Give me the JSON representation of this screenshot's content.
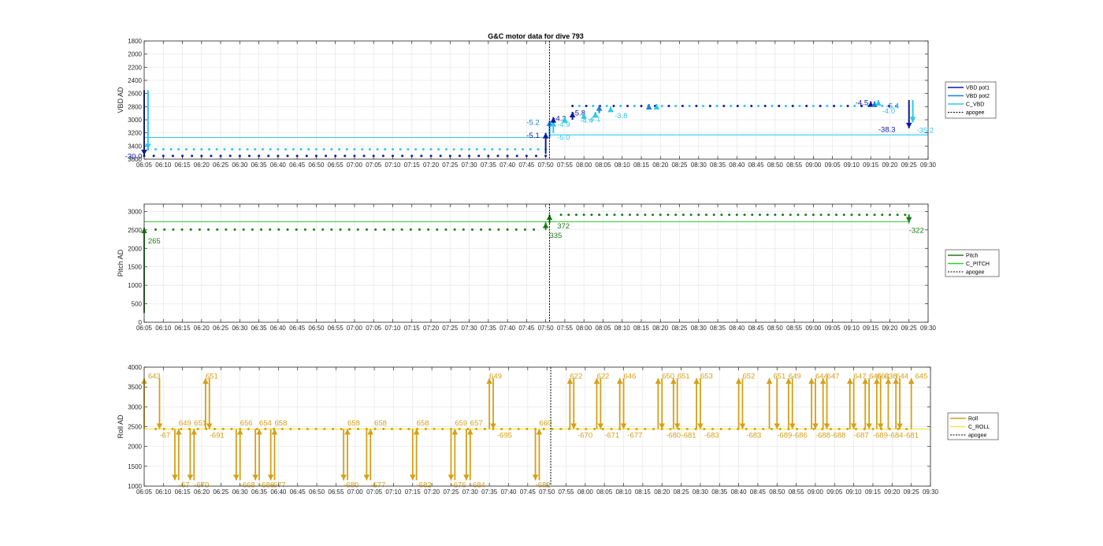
{
  "title": "G&C motor data for dive 793",
  "time_ticks": [
    "06:05",
    "06:10",
    "06:15",
    "06:20",
    "06:25",
    "06:30",
    "06:35",
    "06:40",
    "06:45",
    "06:50",
    "06:55",
    "07:00",
    "07:05",
    "07:10",
    "07:15",
    "07:20",
    "07:25",
    "07:30",
    "07:35",
    "07:40",
    "07:45",
    "07:50",
    "07:55",
    "08:00",
    "08:05",
    "08:10",
    "08:15",
    "08:20",
    "08:25",
    "08:30",
    "08:35",
    "08:40",
    "08:45",
    "08:50",
    "08:55",
    "09:00",
    "09:05",
    "09:10",
    "09:15",
    "09:20",
    "09:25",
    "09:30"
  ],
  "colors": {
    "vbd_pot1": "#0b1a9e",
    "vbd_pot2": "#1e7fe0",
    "c_vbd": "#2fc8e8",
    "pitch": "#1f7a1f",
    "c_pitch": "#33cc33",
    "roll": "#d4a017",
    "c_roll": "#f2e64a",
    "apogee": "#000000"
  },
  "chart_data": [
    {
      "type": "line",
      "ylabel": "VBD AD",
      "ylim": [
        1800,
        3600
      ],
      "y_reversed": true,
      "y_ticks": [
        1800,
        2000,
        2200,
        2400,
        2600,
        2800,
        3000,
        3200,
        3400,
        3600
      ],
      "grid": true,
      "legend": "right",
      "legend_entries": [
        "VBD pot1",
        "VBD pot2",
        "C_VBD",
        "apogee"
      ],
      "apogee_time": "07:51",
      "c_vbd_steps": [
        [
          "06:05",
          3270
        ],
        [
          "07:51",
          3270
        ],
        [
          "07:51",
          3230
        ],
        [
          "09:30",
          3230
        ]
      ],
      "vbd_pot1_points": {
        "t_start": "06:05",
        "t_end": "07:50",
        "step_min": 2.5,
        "value": 3550
      },
      "vbd_pot2_points": {
        "t_start": "06:06",
        "t_end": "07:50",
        "step_min": 2.0,
        "value": 3450
      },
      "vbd_after_apogee": {
        "t_start": "07:57",
        "t_end": "09:23",
        "step_min": 1.8,
        "value": 2790
      },
      "moves": [
        {
          "t": "06:05",
          "from": 2550,
          "to": 3540,
          "series": "vbd_pot1",
          "label": "-30.0",
          "lt": "06:00",
          "lv": 3560
        },
        {
          "t": "06:06",
          "from": 2550,
          "to": 3450,
          "series": "c_vbd",
          "label": "",
          "lt": "06:06",
          "lv": 3450
        },
        {
          "t": "07:50",
          "from": 3520,
          "to": 3200,
          "series": "vbd_pot1",
          "label": "-5.1",
          "lt": "07:45",
          "lv": 3240
        },
        {
          "t": "07:51",
          "from": 3280,
          "to": 3010,
          "series": "vbd_pot2",
          "label": "-5.2",
          "lt": "07:45",
          "lv": 3040
        },
        {
          "t": "07:52",
          "from": 3200,
          "to": 3020,
          "series": "c_vbd",
          "label": "-5.0",
          "lt": "07:53",
          "lv": 3270
        },
        {
          "t": "07:52",
          "from": 3050,
          "to": 2960,
          "series": "vbd_pot1",
          "label": "-4.3",
          "lt": "07:52",
          "lv": 2980
        },
        {
          "t": "07:55",
          "from": 3050,
          "to": 2960,
          "series": "c_vbd",
          "label": "-4.9",
          "lt": "07:53",
          "lv": 3070
        },
        {
          "t": "07:57",
          "from": 3000,
          "to": 2880,
          "series": "vbd_pot1",
          "label": "-5.8",
          "lt": "07:57",
          "lv": 2900
        },
        {
          "t": "08:00",
          "from": 2990,
          "to": 2900,
          "series": "c_vbd",
          "label": "-4.4",
          "lt": "07:59",
          "lv": 3010
        },
        {
          "t": "08:03",
          "from": 2970,
          "to": 2880,
          "series": "c_vbd",
          "label": "-4.1",
          "lt": "08:01",
          "lv": 2990
        },
        {
          "t": "08:04",
          "from": 2900,
          "to": 2780,
          "series": "vbd_pot2",
          "label": "",
          "lt": "08:04",
          "lv": 2780
        },
        {
          "t": "08:07",
          "from": 2850,
          "to": 2800,
          "series": "c_vbd",
          "label": "-3.8",
          "lt": "08:08",
          "lv": 2940
        },
        {
          "t": "08:17",
          "from": 2820,
          "to": 2760,
          "series": "vbd_pot2",
          "label": "",
          "lt": "08:17",
          "lv": 2760
        },
        {
          "t": "08:19",
          "from": 2820,
          "to": 2760,
          "series": "c_vbd",
          "label": "",
          "lt": "08:19",
          "lv": 2760
        },
        {
          "t": "09:15",
          "from": 2780,
          "to": 2720,
          "series": "vbd_pot1",
          "label": "-4.5",
          "lt": "09:11",
          "lv": 2740
        },
        {
          "t": "09:16",
          "from": 2780,
          "to": 2720,
          "series": "vbd_pot2",
          "label": "-5.4",
          "lt": "09:19",
          "lv": 2790
        },
        {
          "t": "09:17",
          "from": 2780,
          "to": 2700,
          "series": "c_vbd",
          "label": "-4.0",
          "lt": "09:18",
          "lv": 2870
        },
        {
          "t": "09:25",
          "from": 2700,
          "to": 3130,
          "series": "vbd_pot1",
          "label": "-38.3",
          "lt": "09:17",
          "lv": 3150
        },
        {
          "t": "09:26",
          "from": 2700,
          "to": 3040,
          "series": "c_vbd",
          "label": "-35.2",
          "lt": "09:27",
          "lv": 3160
        }
      ]
    },
    {
      "type": "line",
      "ylabel": "Pitch AD",
      "ylim": [
        0,
        3200
      ],
      "y_ticks": [
        0,
        500,
        1000,
        1500,
        2000,
        2500,
        3000
      ],
      "grid": true,
      "legend": "right",
      "legend_entries": [
        "Pitch",
        "C_PITCH",
        "apogee"
      ],
      "apogee_time": "07:51",
      "c_pitch": [
        [
          "06:05",
          2720
        ],
        [
          "09:25",
          2720
        ],
        [
          "09:25",
          2660
        ]
      ],
      "pitch_before": {
        "t_start": "06:08",
        "t_end": "07:48",
        "step_min": 2.3,
        "value": 2510
      },
      "pitch_after": {
        "t_start": "07:54",
        "t_end": "09:24",
        "step_min": 2.0,
        "value": 2910
      },
      "moves": [
        {
          "t": "06:05",
          "from": 250,
          "to": 2560,
          "label": "265",
          "lt": "06:06",
          "lv": 2200
        },
        {
          "t": "07:50",
          "from": 2500,
          "to": 2700,
          "label": "335",
          "lt": "07:51",
          "lv": 2350
        },
        {
          "t": "07:51",
          "from": 2680,
          "to": 2920,
          "label": "372",
          "lt": "07:53",
          "lv": 2600
        },
        {
          "t": "09:25",
          "from": 2920,
          "to": 2700,
          "label": "-322",
          "lt": "09:25",
          "lv": 2490
        }
      ]
    },
    {
      "type": "line",
      "ylabel": "Roll AD",
      "ylim": [
        1000,
        4000
      ],
      "y_ticks": [
        1000,
        1500,
        2000,
        2500,
        3000,
        3500,
        4000
      ],
      "grid": true,
      "legend": "right",
      "legend_entries": [
        "Roll",
        "C_ROLL",
        "apogee"
      ],
      "apogee_time": "07:51",
      "c_roll_value": 2440,
      "roll_points": {
        "t_start": "06:08",
        "t_end": "09:24",
        "step_min": 2.2,
        "value": 2440
      },
      "moves": [
        {
          "t": "06:05",
          "from": 2440,
          "to": 3720,
          "label": "643",
          "lt": "06:06",
          "lv": 3770
        },
        {
          "t": "06:09",
          "from": 3720,
          "to": 2440,
          "label": "-67",
          "lt": "06:09",
          "lv": 2280
        },
        {
          "t": "06:13",
          "from": 2440,
          "to": 1150,
          "label": "-67",
          "lt": "06:14",
          "lv": 1030
        },
        {
          "t": "06:14",
          "from": 1150,
          "to": 2440,
          "label": "649",
          "lt": "06:14",
          "lv": 2590
        },
        {
          "t": "06:17",
          "from": 2440,
          "to": 1150,
          "label": "-670",
          "lt": "06:18",
          "lv": 1030
        },
        {
          "t": "06:18",
          "from": 1150,
          "to": 2440,
          "label": "651",
          "lt": "06:18",
          "lv": 2590
        },
        {
          "t": "06:21",
          "from": 2440,
          "to": 3720,
          "label": "651",
          "lt": "06:21",
          "lv": 3770
        },
        {
          "t": "06:22",
          "from": 3720,
          "to": 2440,
          "label": "-691",
          "lt": "06:22",
          "lv": 2280
        },
        {
          "t": "06:29",
          "from": 2440,
          "to": 1150,
          "label": "-668",
          "lt": "06:30",
          "lv": 1030
        },
        {
          "t": "06:30",
          "from": 1150,
          "to": 2440,
          "label": "656",
          "lt": "06:30",
          "lv": 2590
        },
        {
          "t": "06:34",
          "from": 2440,
          "to": 1150,
          "label": "-686",
          "lt": "06:35",
          "lv": 1030
        },
        {
          "t": "06:35",
          "from": 1150,
          "to": 2440,
          "label": "654",
          "lt": "06:35",
          "lv": 2590
        },
        {
          "t": "06:38",
          "from": 2440,
          "to": 1150,
          "label": "-677",
          "lt": "06:38",
          "lv": 1030
        },
        {
          "t": "06:39",
          "from": 1150,
          "to": 2440,
          "label": "658",
          "lt": "06:39",
          "lv": 2590
        },
        {
          "t": "06:57",
          "from": 2440,
          "to": 1150,
          "label": "-680",
          "lt": "06:57",
          "lv": 1030
        },
        {
          "t": "06:58",
          "from": 1150,
          "to": 2440,
          "label": "658",
          "lt": "06:58",
          "lv": 2590
        },
        {
          "t": "07:03",
          "from": 2440,
          "to": 1150,
          "label": "-677",
          "lt": "07:04",
          "lv": 1030
        },
        {
          "t": "07:04",
          "from": 1150,
          "to": 2440,
          "label": "658",
          "lt": "07:05",
          "lv": 2590
        },
        {
          "t": "07:15",
          "from": 2440,
          "to": 1150,
          "label": "-682",
          "lt": "07:16",
          "lv": 1030
        },
        {
          "t": "07:16",
          "from": 1150,
          "to": 2440,
          "label": "658",
          "lt": "07:16",
          "lv": 2590
        },
        {
          "t": "07:25",
          "from": 2440,
          "to": 1150,
          "label": "-676",
          "lt": "07:25",
          "lv": 1030
        },
        {
          "t": "07:26",
          "from": 1150,
          "to": 2440,
          "label": "659",
          "lt": "07:26",
          "lv": 2590
        },
        {
          "t": "07:29",
          "from": 2440,
          "to": 1150,
          "label": "-684",
          "lt": "07:30",
          "lv": 1030
        },
        {
          "t": "07:30",
          "from": 1150,
          "to": 2440,
          "label": "657",
          "lt": "07:30",
          "lv": 2590
        },
        {
          "t": "07:35",
          "from": 2440,
          "to": 3720,
          "label": "649",
          "lt": "07:35",
          "lv": 3770
        },
        {
          "t": "07:36",
          "from": 3720,
          "to": 2440,
          "label": "-695",
          "lt": "07:37",
          "lv": 2280
        },
        {
          "t": "07:47",
          "from": 2440,
          "to": 1150,
          "label": "-682",
          "lt": "07:47",
          "lv": 1030
        },
        {
          "t": "07:48",
          "from": 1150,
          "to": 2440,
          "label": "660",
          "lt": "07:48",
          "lv": 2590
        },
        {
          "t": "07:56",
          "from": 2440,
          "to": 3720,
          "label": "622",
          "lt": "07:56",
          "lv": 3770
        },
        {
          "t": "07:57",
          "from": 3720,
          "to": 2440,
          "label": "-670",
          "lt": "07:58",
          "lv": 2280
        },
        {
          "t": "08:03",
          "from": 2440,
          "to": 3720,
          "label": "622",
          "lt": "08:03",
          "lv": 3770
        },
        {
          "t": "08:04",
          "from": 3720,
          "to": 2440,
          "label": "-671",
          "lt": "08:05",
          "lv": 2280
        },
        {
          "t": "08:09",
          "from": 2440,
          "to": 3720,
          "label": "646",
          "lt": "08:10",
          "lv": 3770
        },
        {
          "t": "08:10",
          "from": 3720,
          "to": 2440,
          "label": "-677",
          "lt": "08:11",
          "lv": 2280
        },
        {
          "t": "08:19",
          "from": 2440,
          "to": 3720,
          "label": "650",
          "lt": "08:20",
          "lv": 3770
        },
        {
          "t": "08:20",
          "from": 3720,
          "to": 2440,
          "label": "-680",
          "lt": "08:21",
          "lv": 2280
        },
        {
          "t": "08:23",
          "from": 2440,
          "to": 3720,
          "label": "651",
          "lt": "08:24",
          "lv": 3770
        },
        {
          "t": "08:24",
          "from": 3720,
          "to": 2440,
          "label": "-681",
          "lt": "08:25",
          "lv": 2280
        },
        {
          "t": "08:29",
          "from": 2440,
          "to": 3720,
          "label": "653",
          "lt": "08:30",
          "lv": 3770
        },
        {
          "t": "08:30",
          "from": 3720,
          "to": 2440,
          "label": "-683",
          "lt": "08:31",
          "lv": 2280
        },
        {
          "t": "08:40",
          "from": 2440,
          "to": 3720,
          "label": "652",
          "lt": "08:41",
          "lv": 3770
        },
        {
          "t": "08:41",
          "from": 3720,
          "to": 2440,
          "label": "-683",
          "lt": "08:42",
          "lv": 2280
        },
        {
          "t": "08:48",
          "from": 2440,
          "to": 3720,
          "label": "651",
          "lt": "08:49",
          "lv": 3770
        },
        {
          "t": "08:50",
          "from": 3720,
          "to": 2440,
          "label": "-689",
          "lt": "08:50",
          "lv": 2280
        },
        {
          "t": "08:53",
          "from": 2440,
          "to": 3720,
          "label": "649",
          "lt": "08:53",
          "lv": 3770
        },
        {
          "t": "08:54",
          "from": 3720,
          "to": 2440,
          "label": "-686",
          "lt": "08:54",
          "lv": 2280
        },
        {
          "t": "08:59",
          "from": 2440,
          "to": 3720,
          "label": "644",
          "lt": "09:00",
          "lv": 3770
        },
        {
          "t": "09:00",
          "from": 3720,
          "to": 2440,
          "label": "-688",
          "lt": "09:00",
          "lv": 2280
        },
        {
          "t": "09:02",
          "from": 2440,
          "to": 3720,
          "label": "647",
          "lt": "09:03",
          "lv": 3770
        },
        {
          "t": "09:03",
          "from": 3720,
          "to": 2440,
          "label": "-688",
          "lt": "09:04",
          "lv": 2280
        },
        {
          "t": "09:09",
          "from": 2440,
          "to": 3720,
          "label": "647",
          "lt": "09:10",
          "lv": 3770
        },
        {
          "t": "09:10",
          "from": 3720,
          "to": 2440,
          "label": "-687",
          "lt": "09:10",
          "lv": 2280
        },
        {
          "t": "09:13",
          "from": 2440,
          "to": 3720,
          "label": "646",
          "lt": "09:14",
          "lv": 3770
        },
        {
          "t": "09:14",
          "from": 3720,
          "to": 2440,
          "label": "-689",
          "lt": "09:15",
          "lv": 2280
        },
        {
          "t": "09:16",
          "from": 2440,
          "to": 3720,
          "label": "663",
          "lt": "09:16",
          "lv": 3770
        },
        {
          "t": "09:17",
          "from": 3720,
          "to": 2440,
          "label": "-684",
          "lt": "09:19",
          "lv": 2280
        },
        {
          "t": "09:19",
          "from": 2440,
          "to": 3720,
          "label": "638",
          "lt": "09:18",
          "lv": 3770
        },
        {
          "t": "09:21",
          "from": 2440,
          "to": 3720,
          "label": "644",
          "lt": "09:21",
          "lv": 3770
        },
        {
          "t": "09:22",
          "from": 3720,
          "to": 2440,
          "label": "-681",
          "lt": "09:23",
          "lv": 2280
        },
        {
          "t": "09:25",
          "from": 2440,
          "to": 3720,
          "label": "645",
          "lt": "09:26",
          "lv": 3770
        }
      ]
    }
  ]
}
